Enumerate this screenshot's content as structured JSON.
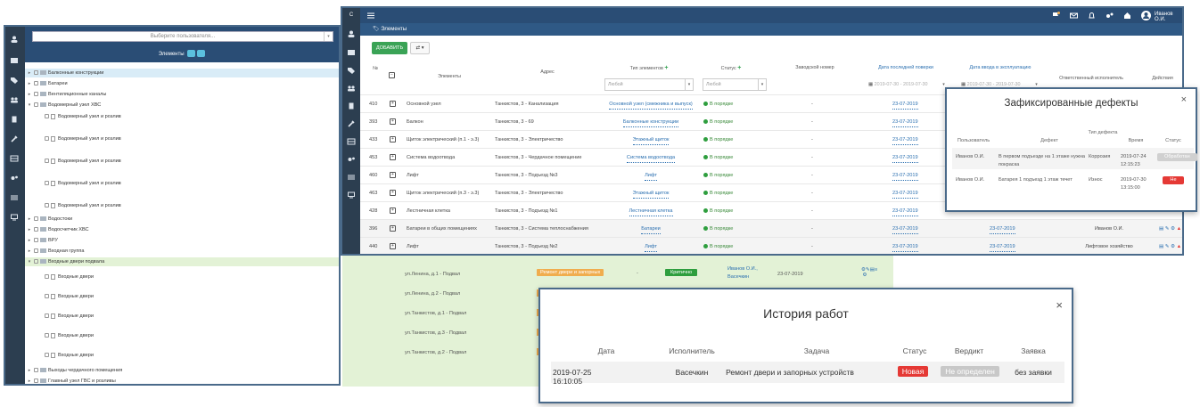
{
  "left": {
    "user_placeholder": "Выберите пользователя...",
    "header": "Элементы",
    "tree": [
      {
        "label": "Балконные конструкции",
        "type": "folder",
        "selected": true
      },
      {
        "label": "Батареи",
        "type": "folder"
      },
      {
        "label": "Вентиляционные каналы",
        "type": "folder"
      },
      {
        "label": "Водомерный узел ХВС",
        "type": "folder",
        "open": true
      },
      {
        "label": "Водомерный узел и розлив",
        "type": "file"
      },
      {
        "label": "Водомерный узел и розлив",
        "type": "file"
      },
      {
        "label": "Водомерный узел и розлив",
        "type": "file"
      },
      {
        "label": "Водомерный узел и розлив",
        "type": "file"
      },
      {
        "label": "Водомерный узел и розлив",
        "type": "file"
      },
      {
        "label": "Водостоки",
        "type": "folder"
      },
      {
        "label": "Водосчетчик ХВС",
        "type": "folder"
      },
      {
        "label": "ВРУ",
        "type": "folder"
      },
      {
        "label": "Входная группа",
        "type": "folder"
      },
      {
        "label": "Входные двери подвала",
        "type": "folder",
        "open": true,
        "green": true
      },
      {
        "label": "Входные двери",
        "type": "file"
      },
      {
        "label": "Входные двери",
        "type": "file"
      },
      {
        "label": "Входные двери",
        "type": "file"
      },
      {
        "label": "Входные двери",
        "type": "file"
      },
      {
        "label": "Входные двери",
        "type": "file"
      },
      {
        "label": "Выходы чердачного помещения",
        "type": "folder"
      },
      {
        "label": "Главный узел ГВС и розливы",
        "type": "folder"
      }
    ]
  },
  "green_rows": [
    {
      "address": "ул.Ленина, д.1 - Подвал",
      "task": "Ремонт двери и запорных",
      "dash": "-",
      "status": "Критично",
      "people": "Иванов О.И., Васечкин",
      "date": "23-07-2019"
    },
    {
      "address": "ул.Ленина, д.2 - Подвал"
    },
    {
      "address": "ул.Танкистов, д.1 - Подвал"
    },
    {
      "address": "ул.Танкистов, д.3 - Подвал"
    },
    {
      "address": "ул.Танкистов, д.2 - Подвал"
    }
  ],
  "main": {
    "topbar": {
      "user": "Иванов О.И."
    },
    "breadcrumb": "Элементы",
    "add_label": "ДОБАВИТЬ",
    "config_label": "⇄ ▾",
    "columns": {
      "num": "№",
      "elements": "Элементы",
      "address": "Адрес",
      "type": "Тип элементов",
      "status": "Статус",
      "serial": "Заводской номер",
      "last_check": "Дата последней поверки",
      "commissioned": "Дата ввода в эксплуатацию",
      "responsible": "Ответственный исполнитель",
      "actions": "Действия"
    },
    "filters": {
      "type": "Любой",
      "status": "Любой",
      "date1": "2019-07-30 - 2019-07-30",
      "date2": "2019-07-30 - 2019-07-30"
    },
    "rows": [
      {
        "num": "410",
        "name": "Основной узел",
        "address": "Танкистов, 3 - Канализация",
        "type": "Основной узел (смежника и выпуск)",
        "status": "В порядке",
        "serial": "-",
        "date1": "23-07-2019"
      },
      {
        "num": "393",
        "name": "Балкон",
        "address": "Танкистов, 3 - 69",
        "type": "Балконные конструкции",
        "status": "В порядке",
        "serial": "-",
        "date1": "23-07-2019"
      },
      {
        "num": "433",
        "name": "Щиток электрический (п.1 - э.3)",
        "address": "Танкистов, 3 - Электричество",
        "type": "Этажный щиток",
        "status": "В порядке",
        "serial": "-",
        "date1": "23-07-2019"
      },
      {
        "num": "453",
        "name": "Система водоотвода",
        "address": "Танкистов, 3 - Чердачное помещение",
        "type": "Система водоотвода",
        "status": "В порядке",
        "serial": "-",
        "date1": "23-07-2019"
      },
      {
        "num": "460",
        "name": "Лифт",
        "address": "Танкистов, 3 - Подъезд №3",
        "type": "Лифт",
        "status": "В порядке",
        "serial": "-",
        "date1": "23-07-2019"
      },
      {
        "num": "463",
        "name": "Щиток электрический (п.3 - э.3)",
        "address": "Танкистов, 3 - Электричество",
        "type": "Этажный щиток",
        "status": "В порядке",
        "serial": "-",
        "date1": "23-07-2019"
      },
      {
        "num": "428",
        "name": "Лестничная клетка",
        "address": "Танкистов, 3 - Подъезд №1",
        "type": "Лестничная клетка",
        "status": "В порядке",
        "serial": "-",
        "date1": "23-07-2019"
      },
      {
        "num": "396",
        "name": "Батареи в общих помещениях",
        "address": "Танкистов, 3 - Система теплоснабжения",
        "type": "Батареи",
        "status": "В порядке",
        "serial": "-",
        "date1": "23-07-2019",
        "date2": "23-07-2019",
        "resp": "Иванов О.И."
      },
      {
        "num": "440",
        "name": "Лифт",
        "address": "Танкистов, 3 - Подъезд №2",
        "type": "Лифт",
        "status": "В порядке",
        "serial": "-",
        "date1": "23-07-2019",
        "date2": "23-07-2019",
        "resp": "Лифтовое хозяйство"
      }
    ]
  },
  "defects": {
    "title": "Зафиксированные дефекты",
    "close": "×",
    "headers": {
      "user": "Пользователь",
      "defect": "Дефект",
      "type": "Тип дефекта",
      "time": "Время",
      "status": "Статус"
    },
    "rows": [
      {
        "user": "Иванов О.И.",
        "defect": "В первом подъезде на 1 этаже нужна покраска",
        "type": "Коррозия",
        "time": "2019-07-24 12:15:23",
        "status": "Обработан"
      },
      {
        "user": "Иванов О.И.",
        "defect": "Батарея 1 подъезд 1 этаж течет",
        "type": "Износ",
        "time": "2019-07-30 13:15:00",
        "status": "Не"
      }
    ]
  },
  "history": {
    "title": "История работ",
    "close": "×",
    "headers": {
      "date": "Дата",
      "executor": "Исполнитель",
      "task": "Задача",
      "status": "Статус",
      "verdict": "Вердикт",
      "request": "Заявка"
    },
    "row": {
      "date": "2019-07-25 16:10:05",
      "executor": "Васечкин",
      "task": "Ремонт двери и запорных устройств",
      "status": "Новая",
      "verdict": "Не определен",
      "request": "без заявки"
    }
  },
  "colors": {
    "navy": "#2a4d75",
    "sidebar": "#2c3e50",
    "green": "#3aa356",
    "red": "#e53935",
    "highlight_green": "#e3f2d6",
    "selected_blue": "#d9ecf7"
  }
}
